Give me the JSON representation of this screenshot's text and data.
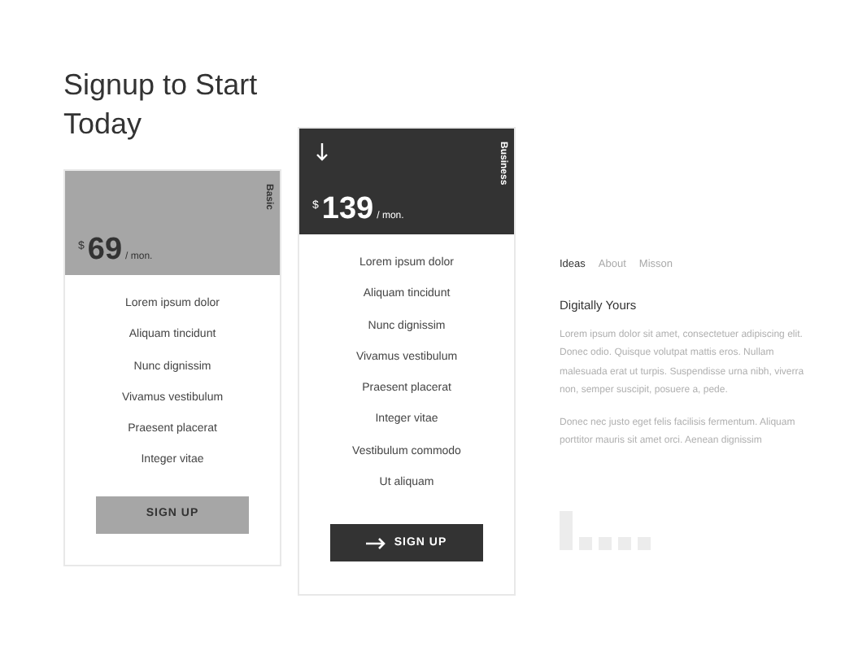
{
  "heading": "Signup to Start Today",
  "plans": [
    {
      "name": "Basic",
      "currency": "$",
      "price": "69",
      "period": "/ mon.",
      "selected": false,
      "features": [
        "Lorem ipsum dolor",
        "Aliquam tincidunt",
        "Nunc dignissim",
        "Vivamus vestibulum",
        "Praesent placerat",
        "Integer vitae"
      ],
      "button": "SIGN UP"
    },
    {
      "name": "Business",
      "currency": "$",
      "price": "139",
      "period": "/ mon.",
      "selected": true,
      "features": [
        "Lorem ipsum dolor",
        "Aliquam tincidunt",
        "Nunc dignissim",
        "Vivamus vestibulum",
        "Praesent placerat",
        "Integer vitae",
        "Vestibulum commodo",
        "Ut aliquam"
      ],
      "button": "SIGN UP"
    }
  ],
  "tabs": [
    {
      "label": "Ideas",
      "selected": true
    },
    {
      "label": "About",
      "selected": false
    },
    {
      "label": "Misson",
      "selected": false
    }
  ],
  "article": {
    "title": "Digitally Yours",
    "paragraphs": [
      "Lorem ipsum dolor sit amet, consectetuer adipiscing elit. Donec odio. Quisque volutpat mattis eros. Nullam malesuada erat ut turpis. Suspendisse urna nibh, viverra non, semper suscipit, posuere a, pede.",
      "Donec nec justo eget felis facilisis fermentum. Aliquam porttitor mauris sit amet orci. Aenean dignissim"
    ]
  },
  "slides": [
    {
      "selected": true
    },
    {
      "selected": false
    },
    {
      "selected": false
    },
    {
      "selected": false
    },
    {
      "selected": false
    }
  ]
}
